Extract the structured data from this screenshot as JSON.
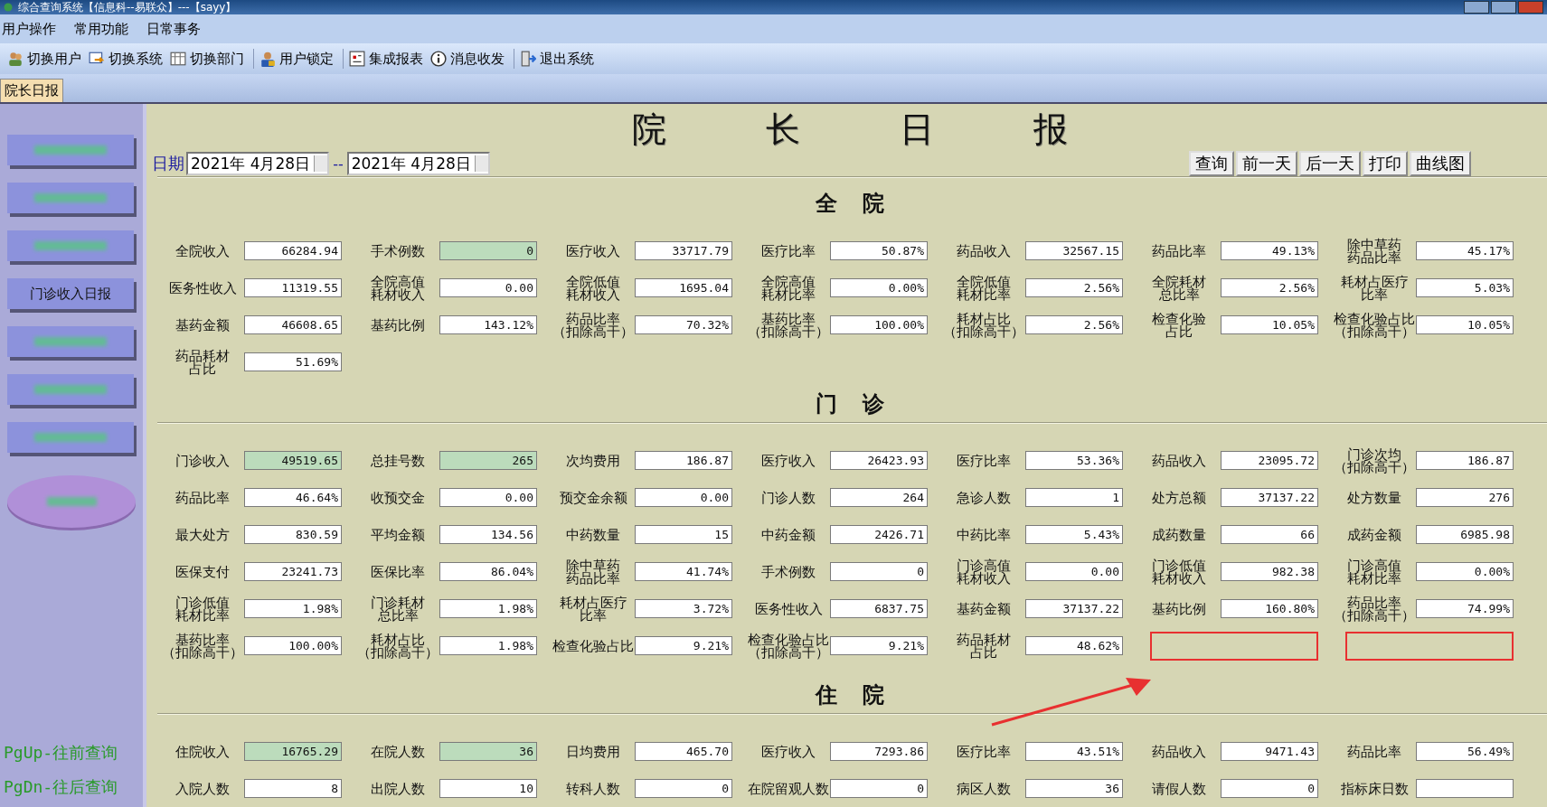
{
  "window": {
    "title": "综合查询系统【信息科--易联众】---【sayy】"
  },
  "menu": [
    "用户操作",
    "常用功能",
    "日常事务"
  ],
  "toolbar": [
    {
      "kind": "users",
      "label": "切换用户"
    },
    {
      "kind": "switch",
      "label": "切换系统"
    },
    {
      "kind": "grid",
      "label": "切换部门"
    },
    {
      "kind": "lock",
      "label": "用户锁定"
    },
    {
      "kind": "report",
      "label": "集成报表"
    },
    {
      "kind": "info",
      "label": "消息收发"
    },
    {
      "kind": "exit",
      "label": "退出系统"
    }
  ],
  "tabs": [
    {
      "label": "院长日报",
      "selected": true
    }
  ],
  "sidebar": {
    "buttons": [
      {
        "kind": "blurred"
      },
      {
        "kind": "blurred"
      },
      {
        "kind": "blurred"
      },
      {
        "kind": "text",
        "label": "门诊收入日报"
      },
      {
        "kind": "blurred"
      },
      {
        "kind": "blurred"
      },
      {
        "kind": "blurred"
      },
      {
        "kind": "oval"
      }
    ],
    "hints": [
      "PgUp-往前查询",
      "PgDn-往后查询"
    ]
  },
  "report": {
    "title": "院长日报",
    "date_label": "日期",
    "date_from": "2021年 4月28日",
    "separator": "--",
    "date_to": "2021年 4月28日",
    "buttons": [
      "查询",
      "前一天",
      "后一天",
      "打印",
      "曲线图"
    ]
  },
  "sections": [
    {
      "heading": "全院",
      "rows": [
        [
          {
            "kind": "field",
            "label_lines": [
              "全院收入"
            ],
            "value": "66284.94",
            "highlighted": false
          },
          {
            "kind": "field",
            "label_lines": [
              "手术例数"
            ],
            "value": "0",
            "highlighted": true
          },
          {
            "kind": "field",
            "label_lines": [
              "医疗收入"
            ],
            "value": "33717.79",
            "highlighted": false
          },
          {
            "kind": "field",
            "label_lines": [
              "医疗比率"
            ],
            "value": "50.87%",
            "highlighted": false
          },
          {
            "kind": "field",
            "label_lines": [
              "药品收入"
            ],
            "value": "32567.15",
            "highlighted": false
          },
          {
            "kind": "field",
            "label_lines": [
              "药品比率"
            ],
            "value": "49.13%",
            "highlighted": false
          },
          {
            "kind": "field",
            "label_lines": [
              "除中草药",
              "药品比率"
            ],
            "value": "45.17%",
            "highlighted": false
          }
        ],
        [
          {
            "kind": "field",
            "label_lines": [
              "医务性收入"
            ],
            "value": "11319.55",
            "highlighted": false
          },
          {
            "kind": "field",
            "label_lines": [
              "全院高值",
              "耗材收入"
            ],
            "value": "0.00",
            "highlighted": false
          },
          {
            "kind": "field",
            "label_lines": [
              "全院低值",
              "耗材收入"
            ],
            "value": "1695.04",
            "highlighted": false
          },
          {
            "kind": "field",
            "label_lines": [
              "全院高值",
              "耗材比率"
            ],
            "value": "0.00%",
            "highlighted": false
          },
          {
            "kind": "field",
            "label_lines": [
              "全院低值",
              "耗材比率"
            ],
            "value": "2.56%",
            "highlighted": false
          },
          {
            "kind": "field",
            "label_lines": [
              "全院耗材",
              "总比率"
            ],
            "value": "2.56%",
            "highlighted": false
          },
          {
            "kind": "field",
            "label_lines": [
              "耗材占医疗",
              "比率"
            ],
            "value": "5.03%",
            "highlighted": false
          }
        ],
        [
          {
            "kind": "field",
            "label_lines": [
              "基药金额"
            ],
            "value": "46608.65",
            "highlighted": false
          },
          {
            "kind": "field",
            "label_lines": [
              "基药比例"
            ],
            "value": "143.12%",
            "highlighted": false
          },
          {
            "kind": "field",
            "label_lines": [
              "药品比率",
              "（扣除高干）"
            ],
            "value": "70.32%",
            "highlighted": false
          },
          {
            "kind": "field",
            "label_lines": [
              "基药比率",
              "（扣除高干）"
            ],
            "value": "100.00%",
            "highlighted": false
          },
          {
            "kind": "field",
            "label_lines": [
              "耗材占比",
              "（扣除高干）"
            ],
            "value": "2.56%",
            "highlighted": false
          },
          {
            "kind": "field",
            "label_lines": [
              "检查化验",
              "占比"
            ],
            "value": "10.05%",
            "highlighted": false
          },
          {
            "kind": "field",
            "label_lines": [
              "检查化验占比",
              "（扣除高干）"
            ],
            "value": "10.05%",
            "highlighted": false
          }
        ],
        [
          {
            "kind": "field",
            "label_lines": [
              "药品耗材",
              "占比"
            ],
            "value": "51.69%",
            "highlighted": false
          }
        ]
      ]
    },
    {
      "heading": "门诊",
      "rows": [
        [
          {
            "kind": "field",
            "label_lines": [
              "门诊收入"
            ],
            "value": "49519.65",
            "highlighted": true
          },
          {
            "kind": "field",
            "label_lines": [
              "总挂号数"
            ],
            "value": "265",
            "highlighted": true
          },
          {
            "kind": "field",
            "label_lines": [
              "次均费用"
            ],
            "value": "186.87",
            "highlighted": false
          },
          {
            "kind": "field",
            "label_lines": [
              "医疗收入"
            ],
            "value": "26423.93",
            "highlighted": false
          },
          {
            "kind": "field",
            "label_lines": [
              "医疗比率"
            ],
            "value": "53.36%",
            "highlighted": false
          },
          {
            "kind": "field",
            "label_lines": [
              "药品收入"
            ],
            "value": "23095.72",
            "highlighted": false
          },
          {
            "kind": "field",
            "label_lines": [
              "门诊次均",
              "（扣除高干）"
            ],
            "value": "186.87",
            "highlighted": false
          }
        ],
        [
          {
            "kind": "field",
            "label_lines": [
              "药品比率"
            ],
            "value": "46.64%",
            "highlighted": false
          },
          {
            "kind": "field",
            "label_lines": [
              "收预交金"
            ],
            "value": "0.00",
            "highlighted": false
          },
          {
            "kind": "field",
            "label_lines": [
              "预交金余额"
            ],
            "value": "0.00",
            "highlighted": false
          },
          {
            "kind": "field",
            "label_lines": [
              "门诊人数"
            ],
            "value": "264",
            "highlighted": false
          },
          {
            "kind": "field",
            "label_lines": [
              "急诊人数"
            ],
            "value": "1",
            "highlighted": false
          },
          {
            "kind": "field",
            "label_lines": [
              "处方总额"
            ],
            "value": "37137.22",
            "highlighted": false
          },
          {
            "kind": "field",
            "label_lines": [
              "处方数量"
            ],
            "value": "276",
            "highlighted": false
          }
        ],
        [
          {
            "kind": "field",
            "label_lines": [
              "最大处方"
            ],
            "value": "830.59",
            "highlighted": false
          },
          {
            "kind": "field",
            "label_lines": [
              "平均金额"
            ],
            "value": "134.56",
            "highlighted": false
          },
          {
            "kind": "field",
            "label_lines": [
              "中药数量"
            ],
            "value": "15",
            "highlighted": false
          },
          {
            "kind": "field",
            "label_lines": [
              "中药金额"
            ],
            "value": "2426.71",
            "highlighted": false
          },
          {
            "kind": "field",
            "label_lines": [
              "中药比率"
            ],
            "value": "5.43%",
            "highlighted": false
          },
          {
            "kind": "field",
            "label_lines": [
              "成药数量"
            ],
            "value": "66",
            "highlighted": false
          },
          {
            "kind": "field",
            "label_lines": [
              "成药金额"
            ],
            "value": "6985.98",
            "highlighted": false
          }
        ],
        [
          {
            "kind": "field",
            "label_lines": [
              "医保支付"
            ],
            "value": "23241.73",
            "highlighted": false
          },
          {
            "kind": "field",
            "label_lines": [
              "医保比率"
            ],
            "value": "86.04%",
            "highlighted": false
          },
          {
            "kind": "field",
            "label_lines": [
              "除中草药",
              "药品比率"
            ],
            "value": "41.74%",
            "highlighted": false
          },
          {
            "kind": "field",
            "label_lines": [
              "手术例数"
            ],
            "value": "0",
            "highlighted": false
          },
          {
            "kind": "field",
            "label_lines": [
              "门诊高值",
              "耗材收入"
            ],
            "value": "0.00",
            "highlighted": false
          },
          {
            "kind": "field",
            "label_lines": [
              "门诊低值",
              "耗材收入"
            ],
            "value": "982.38",
            "highlighted": false
          },
          {
            "kind": "field",
            "label_lines": [
              "门诊高值",
              "耗材比率"
            ],
            "value": "0.00%",
            "highlighted": false
          }
        ],
        [
          {
            "kind": "field",
            "label_lines": [
              "门诊低值",
              "耗材比率"
            ],
            "value": "1.98%",
            "highlighted": false
          },
          {
            "kind": "field",
            "label_lines": [
              "门诊耗材",
              "总比率"
            ],
            "value": "1.98%",
            "highlighted": false
          },
          {
            "kind": "field",
            "label_lines": [
              "耗材占医疗",
              "比率"
            ],
            "value": "3.72%",
            "highlighted": false
          },
          {
            "kind": "field",
            "label_lines": [
              "医务性收入"
            ],
            "value": "6837.75",
            "highlighted": false
          },
          {
            "kind": "field",
            "label_lines": [
              "基药金额"
            ],
            "value": "37137.22",
            "highlighted": false
          },
          {
            "kind": "field",
            "label_lines": [
              "基药比例"
            ],
            "value": "160.80%",
            "highlighted": false
          },
          {
            "kind": "field",
            "label_lines": [
              "药品比率",
              "（扣除高干）"
            ],
            "value": "74.99%",
            "highlighted": false
          }
        ],
        [
          {
            "kind": "field",
            "label_lines": [
              "基药比率",
              "（扣除高干）"
            ],
            "value": "100.00%",
            "highlighted": false
          },
          {
            "kind": "field",
            "label_lines": [
              "耗材占比",
              "（扣除高干）"
            ],
            "value": "1.98%",
            "highlighted": false
          },
          {
            "kind": "field",
            "label_lines": [
              "检查化验占比"
            ],
            "value": "9.21%",
            "highlighted": false
          },
          {
            "kind": "field",
            "label_lines": [
              "检查化验占比",
              "（扣除高干）"
            ],
            "value": "9.21%",
            "highlighted": false
          },
          {
            "kind": "field",
            "label_lines": [
              "药品耗材",
              "占比"
            ],
            "value": "48.62%",
            "highlighted": false
          },
          {
            "kind": "marked"
          },
          {
            "kind": "marked"
          }
        ]
      ]
    },
    {
      "heading": "住院",
      "rows": [
        [
          {
            "kind": "field",
            "label_lines": [
              "住院收入"
            ],
            "value": "16765.29",
            "highlighted": true
          },
          {
            "kind": "field",
            "label_lines": [
              "在院人数"
            ],
            "value": "36",
            "highlighted": true
          },
          {
            "kind": "field",
            "label_lines": [
              "日均费用"
            ],
            "value": "465.70",
            "highlighted": false
          },
          {
            "kind": "field",
            "label_lines": [
              "医疗收入"
            ],
            "value": "7293.86",
            "highlighted": false
          },
          {
            "kind": "field",
            "label_lines": [
              "医疗比率"
            ],
            "value": "43.51%",
            "highlighted": false
          },
          {
            "kind": "field",
            "label_lines": [
              "药品收入"
            ],
            "value": "9471.43",
            "highlighted": false
          },
          {
            "kind": "field",
            "label_lines": [
              "药品比率"
            ],
            "value": "56.49%",
            "highlighted": false
          }
        ],
        [
          {
            "kind": "field",
            "label_lines": [
              "入院人数"
            ],
            "value": "8",
            "highlighted": false
          },
          {
            "kind": "field",
            "label_lines": [
              "出院人数"
            ],
            "value": "10",
            "highlighted": false
          },
          {
            "kind": "field",
            "label_lines": [
              "转科人数"
            ],
            "value": "0",
            "highlighted": false
          },
          {
            "kind": "field",
            "label_lines": [
              "在院留观人数"
            ],
            "value": "0",
            "highlighted": false
          },
          {
            "kind": "field",
            "label_lines": [
              "病区人数"
            ],
            "value": "36",
            "highlighted": false
          },
          {
            "kind": "field",
            "label_lines": [
              "请假人数"
            ],
            "value": "0",
            "highlighted": false
          },
          {
            "kind": "field",
            "label_lines": [
              "指标床日数"
            ],
            "highlighted": false
          }
        ]
      ]
    }
  ],
  "annotations": [
    {
      "kind": "arrow"
    }
  ]
}
